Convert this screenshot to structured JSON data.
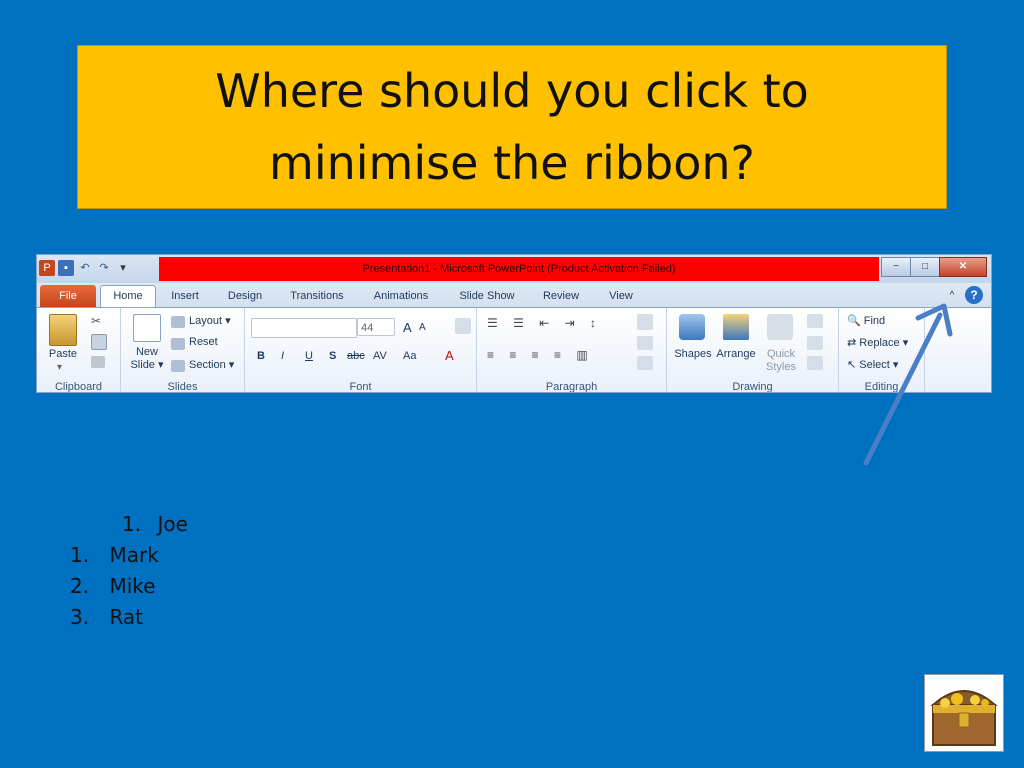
{
  "slide": {
    "title_line1": "Where should you click to",
    "title_line2": "minimise the ribbon?",
    "colors": {
      "background": "#0070C0",
      "title_box": "#FFC000",
      "arrow": "#4a7fc8"
    }
  },
  "window": {
    "title": "Presentation1  -  Microsoft PowerPoint (Product Activation Failed)",
    "qat_icons": [
      "powerpoint-icon",
      "save-icon",
      "undo-icon",
      "redo-icon",
      "customize-icon"
    ],
    "controls": {
      "minimize": "−",
      "maximize": "□",
      "close": "✕"
    }
  },
  "tabs": [
    "File",
    "Home",
    "Insert",
    "Design",
    "Transitions",
    "Animations",
    "Slide Show",
    "Review",
    "View"
  ],
  "ribbon": {
    "clipboard": {
      "label": "Clipboard",
      "paste": "Paste"
    },
    "slides": {
      "label": "Slides",
      "new_slide_1": "New",
      "new_slide_2": "Slide",
      "layout": "Layout",
      "reset": "Reset",
      "section": "Section"
    },
    "font": {
      "label": "Font",
      "size": "44",
      "bold": "B",
      "italic": "I",
      "underline": "U",
      "shadow": "S",
      "strike": "abc",
      "spacing": "AV",
      "case": "Aa",
      "grow": "A",
      "shrink": "A",
      "color": "A"
    },
    "paragraph": {
      "label": "Paragraph"
    },
    "drawing": {
      "label": "Drawing",
      "shapes": "Shapes",
      "arrange": "Arrange",
      "quick_1": "Quick",
      "quick_2": "Styles"
    },
    "editing": {
      "label": "Editing",
      "find": "Find",
      "replace": "Replace",
      "select": "Select"
    }
  },
  "answers": [
    {
      "num": "1.",
      "text": "Joe"
    },
    {
      "num": "1.",
      "text": "Mark"
    },
    {
      "num": "2.",
      "text": "Mike"
    },
    {
      "num": "3.",
      "text": "Rat"
    }
  ]
}
